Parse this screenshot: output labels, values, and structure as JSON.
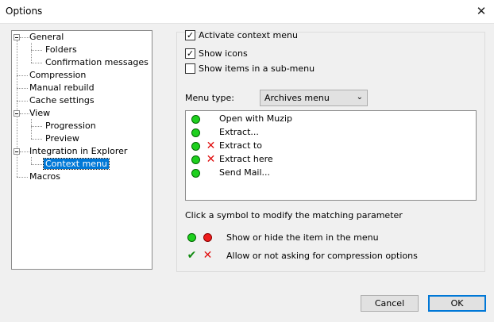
{
  "window": {
    "title": "Options",
    "close_glyph": "✕"
  },
  "tree": {
    "items": [
      {
        "label": "General",
        "expanded": true
      },
      {
        "label": "Folders"
      },
      {
        "label": "Confirmation messages"
      },
      {
        "label": "Compression"
      },
      {
        "label": "Manual rebuild"
      },
      {
        "label": "Cache settings"
      },
      {
        "label": "View",
        "expanded": true
      },
      {
        "label": "Progression"
      },
      {
        "label": "Preview"
      },
      {
        "label": "Integration in Explorer",
        "expanded": true
      },
      {
        "label": "Context menu",
        "selected": true
      },
      {
        "label": "Macros"
      }
    ]
  },
  "options": {
    "activate": {
      "label": "Activate context menu",
      "checked": true,
      "mark": "✓"
    },
    "show_icons": {
      "label": "Show icons",
      "checked": true,
      "mark": "✓"
    },
    "sub_menu": {
      "label": "Show items in a sub-menu",
      "checked": false,
      "mark": ""
    }
  },
  "menu_type": {
    "label": "Menu type:",
    "value": "Archives menu",
    "arrow": "⌄"
  },
  "menu_items": [
    {
      "label": "Open with Muzip",
      "visible": true,
      "ask": false
    },
    {
      "label": "Extract...",
      "visible": true,
      "ask": false
    },
    {
      "label": "Extract to",
      "visible": true,
      "ask": true
    },
    {
      "label": "Extract here",
      "visible": true,
      "ask": true
    },
    {
      "label": "Send Mail...",
      "visible": true,
      "ask": false
    }
  ],
  "legend": {
    "hint": "Click a symbol to modify the matching parameter",
    "visibility": "Show or hide the item in the menu",
    "asking": "Allow or not asking for compression options",
    "check_glyph": "✔",
    "cross_glyph": "✕"
  },
  "buttons": {
    "cancel": "Cancel",
    "ok": "OK"
  },
  "colors": {
    "selection": "#0078d7",
    "green": "#1ed01e",
    "red": "#ee1c1c"
  }
}
